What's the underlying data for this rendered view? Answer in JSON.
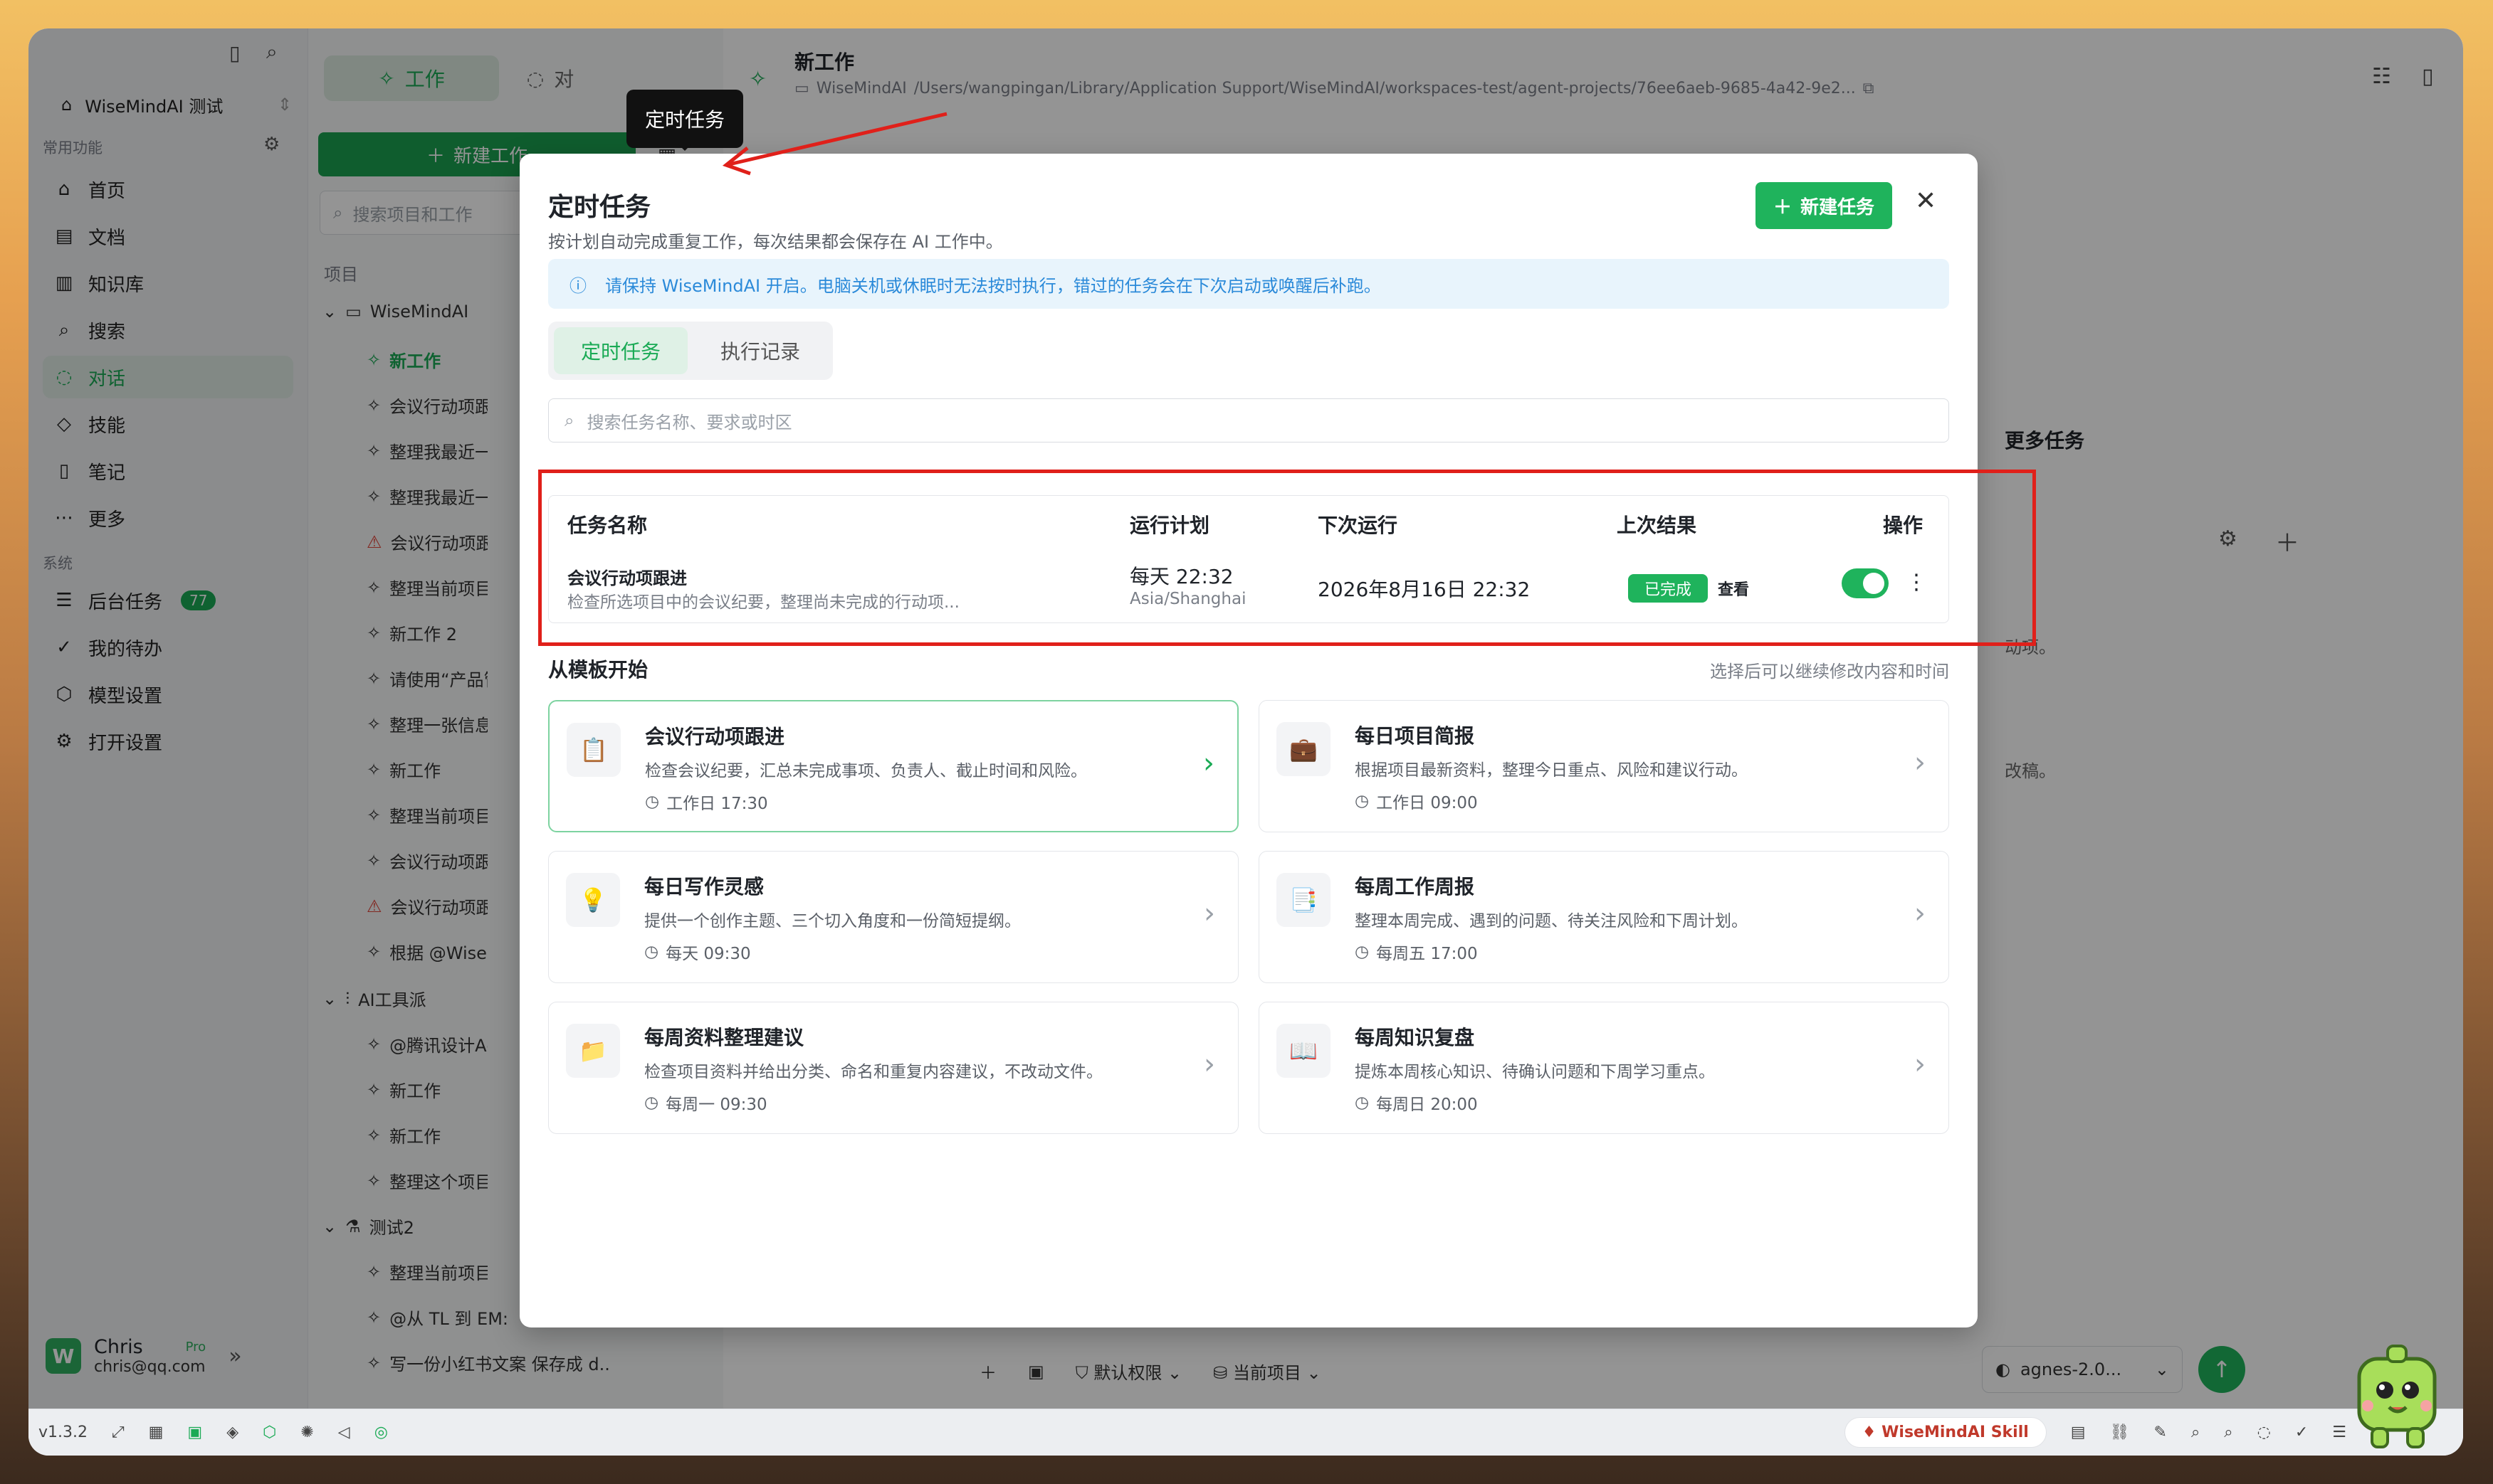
{
  "sidebar": {
    "workspace": "WiseMindAI 测试",
    "common_label": "常用功能",
    "nav": [
      {
        "label": "首页"
      },
      {
        "label": "文档"
      },
      {
        "label": "知识库"
      },
      {
        "label": "搜索"
      },
      {
        "label": "对话"
      },
      {
        "label": "技能"
      },
      {
        "label": "笔记"
      },
      {
        "label": "更多"
      }
    ],
    "system_label": "系统",
    "system": [
      {
        "label": "后台任务",
        "badge": "77"
      },
      {
        "label": "我的待办"
      },
      {
        "label": "模型设置"
      },
      {
        "label": "打开设置"
      }
    ],
    "user": {
      "name": "Chris",
      "email": "chris@qq.com",
      "plan": "Pro",
      "avatar": "W"
    }
  },
  "col2": {
    "tab_work": "工作",
    "tab_chat": "对",
    "new_work": "新建工作",
    "search_placeholder": "搜索项目和工作",
    "projects_label": "项目",
    "groups": [
      {
        "name": "WiseMindAI"
      },
      {
        "name": "AI工具派"
      },
      {
        "name": "测试2"
      }
    ],
    "items": [
      "新工作",
      "会议行动项跟进",
      "整理我最近一周",
      "整理我最近一周",
      "会议行动项跟进",
      "整理当前项目资",
      "新工作 2",
      "请使用“产品管理",
      "整理一张信息图",
      "新工作",
      "整理当前项目资",
      "会议行动项跟进",
      "会议行动项跟进",
      "根据 @WiseMin",
      "@腾讯设计Agen",
      "新工作",
      "新工作",
      "整理这个项目里",
      "整理当前项目资",
      "@从 TL 到 EM:",
      "写一份小红书文案 保存成 d..."
    ]
  },
  "header": {
    "title": "新工作",
    "path_label": "WiseMindAI",
    "path": "/Users/wangpingan/Library/Application Support/WiseMindAI/workspaces-test/agent-projects/76ee6aeb-9685-4a42-9e2..."
  },
  "right_peek": {
    "more_tasks": "更多任务",
    "frag1": "动项。",
    "frag2": "改稿。"
  },
  "composer": {
    "perm": "默认权限",
    "project": "当前项目",
    "model": "agnes-2.0..."
  },
  "bottom": {
    "version": "v1.3.2",
    "skill": "WiseMindAI Skill"
  },
  "tooltip": "定时任务",
  "modal": {
    "title": "定时任务",
    "subtitle": "按计划自动完成重复工作，每次结果都会保存在 AI 工作中。",
    "new_button": "新建任务",
    "info": "请保持 WiseMindAI 开启。电脑关机或休眠时无法按时执行，错过的任务会在下次启动或唤醒后补跑。",
    "tabs": [
      "定时任务",
      "执行记录"
    ],
    "search_placeholder": "搜索任务名称、要求或时区",
    "table": {
      "headers": [
        "任务名称",
        "运行计划",
        "下次运行",
        "上次结果",
        "操作"
      ],
      "row": {
        "name": "会议行动项跟进",
        "desc": "检查所选项目中的会议纪要，整理尚未完成的行动项...",
        "plan": "每天 22:32",
        "tz": "Asia/Shanghai",
        "next": "2026年8月16日 22:32",
        "result": "已完成",
        "view": "查看",
        "enabled": true
      }
    },
    "templates_title": "从模板开始",
    "templates_hint": "选择后可以继续修改内容和时间",
    "templates": [
      {
        "title": "会议行动项跟进",
        "desc": "检查会议纪要，汇总未完成事项、负责人、截止时间和风险。",
        "time": "工作日 17:30",
        "icon": "clipboard-icon"
      },
      {
        "title": "每日项目简报",
        "desc": "根据项目最新资料，整理今日重点、风险和建议行动。",
        "time": "工作日 09:00",
        "icon": "briefcase-icon"
      },
      {
        "title": "每日写作灵感",
        "desc": "提供一个创作主题、三个切入角度和一份简短提纲。",
        "time": "每天 09:30",
        "icon": "lightbulb-icon"
      },
      {
        "title": "每周工作周报",
        "desc": "整理本周完成、遇到的问题、待关注风险和下周计划。",
        "time": "每周五 17:00",
        "icon": "report-icon"
      },
      {
        "title": "每周资料整理建议",
        "desc": "检查项目资料并给出分类、命名和重复内容建议，不改动文件。",
        "time": "每周一 09:30",
        "icon": "folder-icon"
      },
      {
        "title": "每周知识复盘",
        "desc": "提炼本周核心知识、待确认问题和下周学习重点。",
        "time": "每周日 20:00",
        "icon": "book-icon"
      }
    ]
  }
}
